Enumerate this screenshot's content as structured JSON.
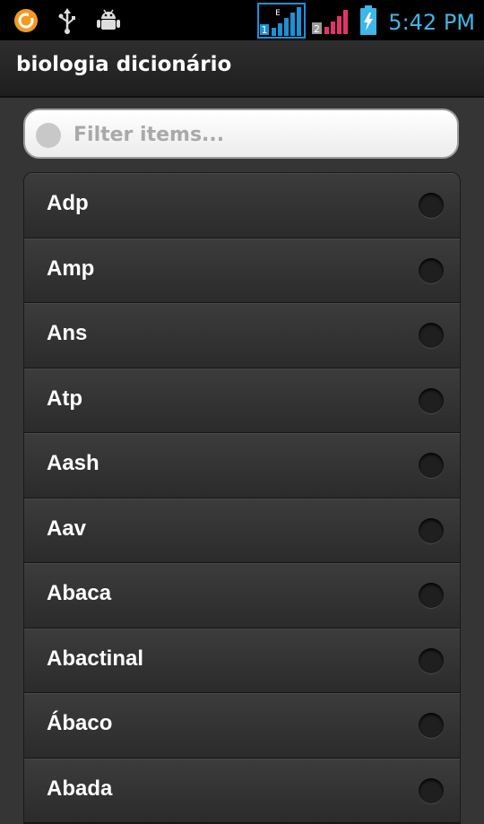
{
  "status_bar": {
    "time": "5:42 PM",
    "sim1_label": "1",
    "sim1_net": "E",
    "sim2_label": "2",
    "icons": [
      "notification-icon",
      "usb-icon",
      "android-debug-icon",
      "sim1-signal-icon",
      "sim2-signal-icon",
      "battery-charging-icon"
    ],
    "sim1_color": "#1e90d6",
    "sim2_color": "#e0356b",
    "battery_color": "#3db6e8",
    "notification_color": "#f29b1e"
  },
  "app": {
    "title": "biologia dicionário"
  },
  "filter": {
    "placeholder": "Filter items...",
    "value": ""
  },
  "list": {
    "items": [
      {
        "label": "Adp"
      },
      {
        "label": "Amp"
      },
      {
        "label": "Ans"
      },
      {
        "label": "Atp"
      },
      {
        "label": "Aash"
      },
      {
        "label": "Aav"
      },
      {
        "label": "Abaca"
      },
      {
        "label": "Abactinal"
      },
      {
        "label": "Ábaco"
      },
      {
        "label": "Abada"
      }
    ]
  }
}
